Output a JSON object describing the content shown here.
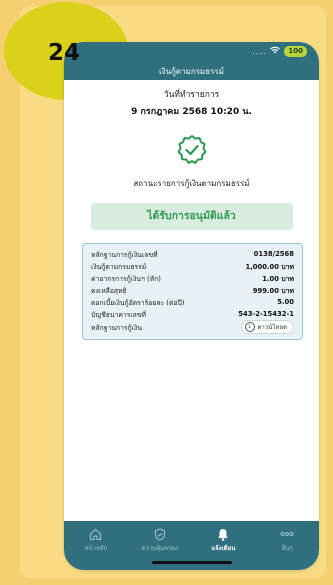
{
  "badge": {
    "number": "24"
  },
  "status_bar": {
    "dots": "....",
    "battery": "100"
  },
  "header": {
    "title": "เงินกู้ตามกรมธรรม์"
  },
  "transaction": {
    "date_label": "วันที่ทำรายการ",
    "date_value": "9 กรกฎาคม 2568 10:20 น.",
    "status_label": "สถานะรายการกู้เงินตามกรมธรรม์",
    "approved_text": "ได้รับการอนุมัติแล้ว"
  },
  "details": {
    "rows": [
      {
        "label": "หลักฐานการกู้เงินเลขที่",
        "value": "0138/2568"
      },
      {
        "label": "เงินกู้ตามกรมธรรม์",
        "value": "1,000.00 บาท"
      },
      {
        "label": "ค่าอากรการกู้เงินฯ (หัก)",
        "value": "1.00 บาท"
      },
      {
        "label": "คงเหลือสุทธิ",
        "value": "999.00 บาท"
      },
      {
        "label": "ดอกเบี้ยเงินกู้อัตราร้อยละ (ต่อปี)",
        "value": "5.00"
      },
      {
        "label": "บัญชีธนาคารเลขที่",
        "value": "543-2-15432-1"
      }
    ],
    "proof_label": "หลักฐานการกู้เงิน",
    "download_label": "ดาวน์โหลด"
  },
  "nav": {
    "items": [
      {
        "label": "หน้าหลัก",
        "icon": "home-icon",
        "active": false
      },
      {
        "label": "ความคุ้มครอง",
        "icon": "shield-icon",
        "active": false
      },
      {
        "label": "แจ้งเตือน",
        "icon": "bell-icon",
        "active": true
      },
      {
        "label": "อื่นๆ",
        "icon": "more-icon",
        "active": false
      }
    ]
  },
  "colors": {
    "primary": "#2f6f7e",
    "approved_text": "#2e9a55",
    "approved_bg": "#d9ece0",
    "background": "#f6d070",
    "badge": "#d9d11a"
  }
}
